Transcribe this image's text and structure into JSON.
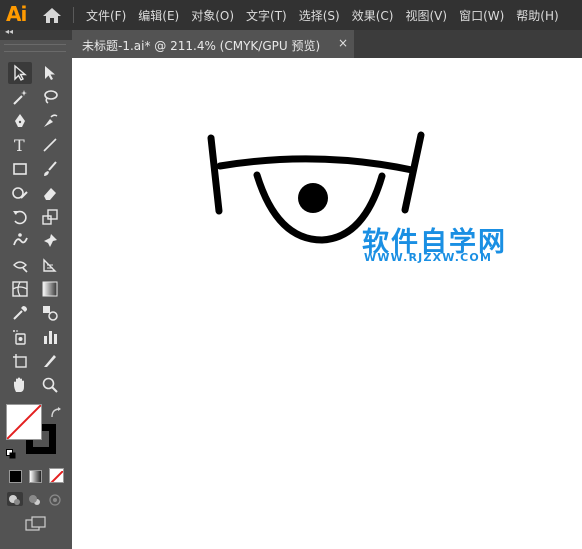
{
  "app": {
    "logo_text": "Ai",
    "brand_color": "#ff9a00"
  },
  "menu": {
    "items": [
      "文件(F)",
      "编辑(E)",
      "对象(O)",
      "文字(T)",
      "选择(S)",
      "效果(C)",
      "视图(V)",
      "窗口(W)",
      "帮助(H)"
    ]
  },
  "panel": {
    "collapse_label": "◂◂"
  },
  "document_tab": {
    "title": "未标题-1.ai* @ 211.4% (CMYK/GPU 预览)",
    "close_label": "×"
  },
  "tools": [
    "selection-tool",
    "direct-selection-tool",
    "magic-wand-tool",
    "lasso-tool",
    "pen-tool",
    "curvature-tool",
    "type-tool",
    "line-segment-tool",
    "rectangle-tool",
    "paintbrush-tool",
    "shaper-tool",
    "eraser-tool",
    "rotate-tool",
    "scale-tool",
    "puppet-warp-tool",
    "pin-tool",
    "free-transform-tool",
    "shape-builder-tool",
    "mesh-tool",
    "gradient-tool",
    "eyedropper-tool",
    "blend-tool",
    "symbol-sprayer-tool",
    "column-graph-tool",
    "artboard-tool",
    "slice-tool",
    "hand-tool",
    "zoom-tool"
  ],
  "colors": {
    "fill": "none",
    "stroke": "#000000",
    "watermark": "#1a8fe3"
  },
  "watermark": {
    "title": "软件自学网",
    "url": "WWW.RJZXW.COM"
  }
}
